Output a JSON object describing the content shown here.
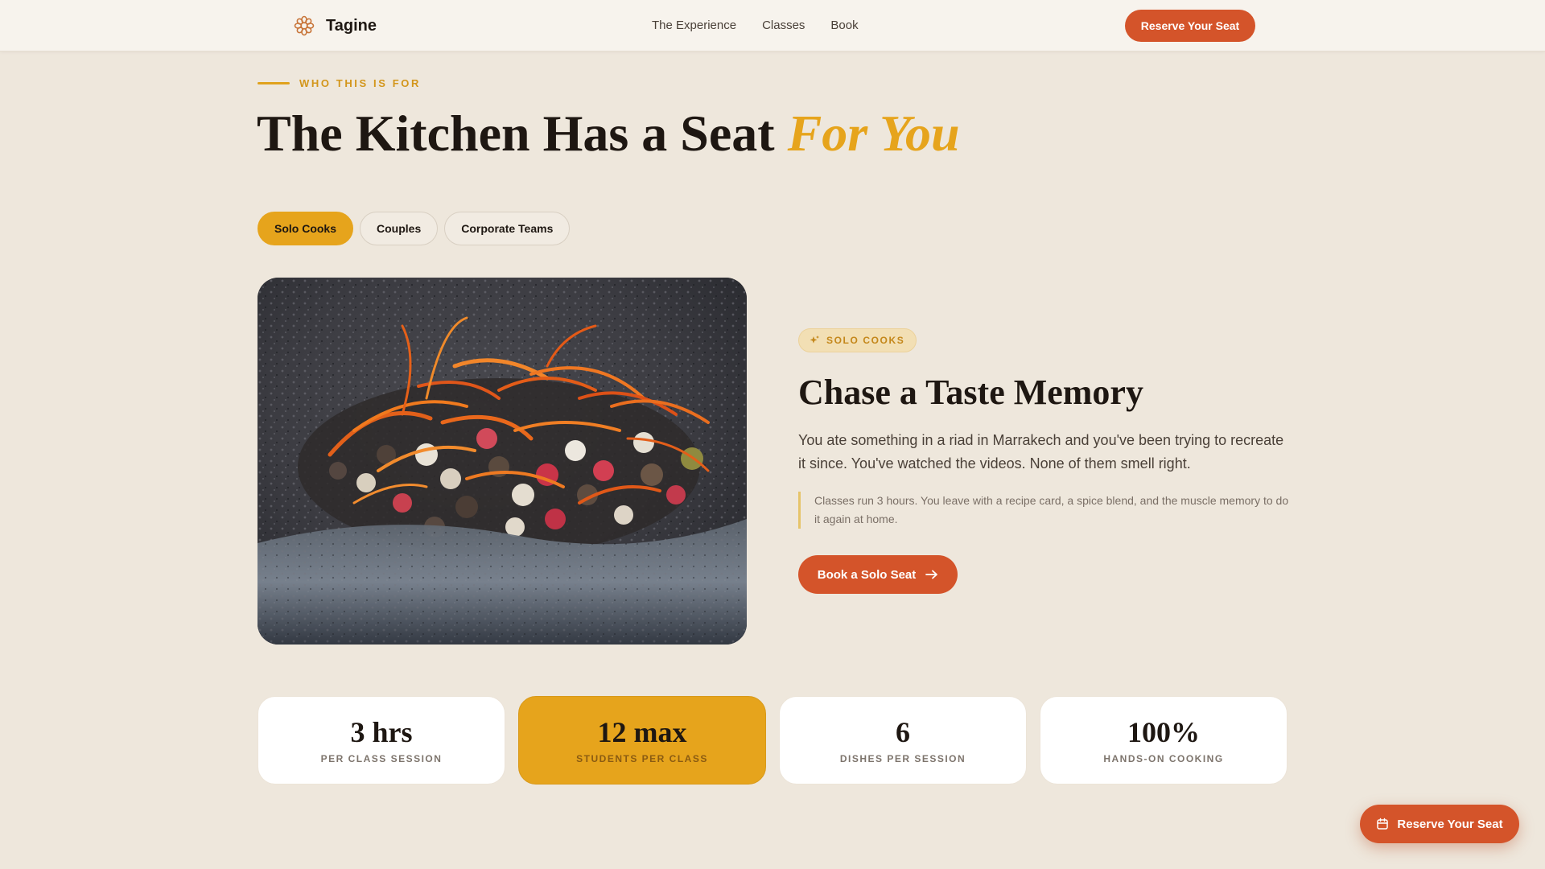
{
  "header": {
    "brand": "Tagine",
    "brand_icon": "flower-emblem-icon",
    "nav": [
      "The Experience",
      "Classes",
      "Book"
    ],
    "cta": "Reserve Your Seat"
  },
  "section": {
    "eyebrow": "WHO THIS IS FOR",
    "title_main": "The Kitchen Has a Seat ",
    "title_highlight": "For You"
  },
  "tabs": [
    {
      "label": "Solo Cooks",
      "active": true
    },
    {
      "label": "Couples",
      "active": false
    },
    {
      "label": "Corporate Teams",
      "active": false
    }
  ],
  "image": {
    "subject": "saffron-and-peppercorns-in-stone-mortar"
  },
  "panel": {
    "badge": "SOLO COOKS",
    "badge_icon": "sparkle-icon",
    "heading": "Chase a Taste Memory",
    "body": "You ate something in a riad in Marrakech and you've been trying to recreate it since. You've watched the videos. None of them smell right.",
    "quote": "Classes run 3 hours. You leave with a recipe card, a spice blend, and the muscle memory to do it again at home.",
    "cta": "Book a Solo Seat",
    "cta_icon": "arrow-right-icon"
  },
  "stats": [
    {
      "value": "3 hrs",
      "label": "PER CLASS SESSION",
      "highlight": false
    },
    {
      "value": "12 max",
      "label": "STUDENTS PER CLASS",
      "highlight": true
    },
    {
      "value": "6",
      "label": "DISHES PER SESSION",
      "highlight": false
    },
    {
      "value": "100%",
      "label": "HANDS-ON COOKING",
      "highlight": false
    }
  ],
  "floating_cta": {
    "label": "Reserve Your Seat",
    "icon": "calendar-icon"
  },
  "colors": {
    "background": "#eee7dc",
    "accent_orange": "#d4542a",
    "accent_gold": "#e6a41c",
    "text_dark": "#1e1712"
  }
}
